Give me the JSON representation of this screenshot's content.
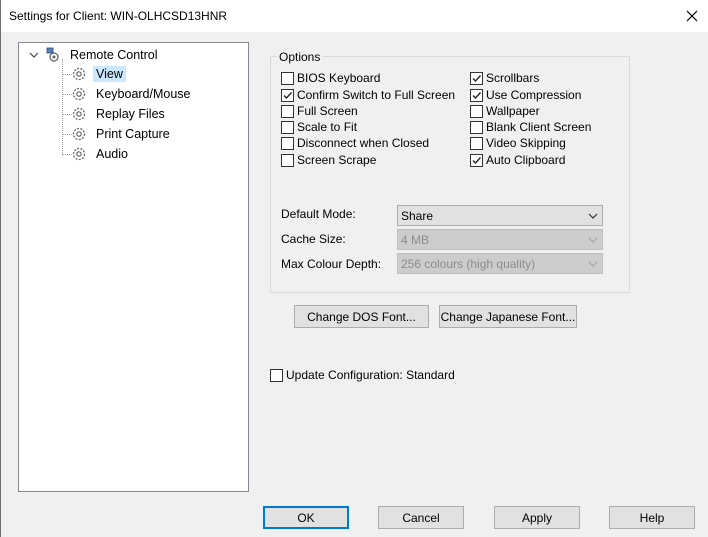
{
  "window": {
    "title": "Settings for Client: WIN-OLHCSD13HNR"
  },
  "tree": {
    "root": "Remote Control",
    "items": [
      {
        "label": "View",
        "selected": true
      },
      {
        "label": "Keyboard/Mouse",
        "selected": false
      },
      {
        "label": "Replay Files",
        "selected": false
      },
      {
        "label": "Print Capture",
        "selected": false
      },
      {
        "label": "Audio",
        "selected": false
      }
    ]
  },
  "options": {
    "group_label": "Options",
    "left": [
      {
        "label": "BIOS Keyboard",
        "checked": false
      },
      {
        "label": "Confirm Switch to Full Screen",
        "checked": true
      },
      {
        "label": "Full Screen",
        "checked": false
      },
      {
        "label": "Scale to Fit",
        "checked": false
      },
      {
        "label": "Disconnect when Closed",
        "checked": false
      },
      {
        "label": "Screen Scrape",
        "checked": false
      }
    ],
    "right": [
      {
        "label": "Scrollbars",
        "checked": true
      },
      {
        "label": "Use Compression",
        "checked": true
      },
      {
        "label": "Wallpaper",
        "checked": false
      },
      {
        "label": "Blank Client Screen",
        "checked": false
      },
      {
        "label": "Video Skipping",
        "checked": false
      },
      {
        "label": "Auto Clipboard",
        "checked": true
      }
    ],
    "default_mode": {
      "label": "Default Mode:",
      "value": "Share"
    },
    "cache_size": {
      "label": "Cache Size:",
      "value": "4 MB"
    },
    "max_colour_depth": {
      "label": "Max Colour Depth:",
      "value": "256 colours (high quality)"
    }
  },
  "font_buttons": {
    "dos": "Change DOS Font...",
    "japanese": "Change Japanese Font..."
  },
  "update_config": {
    "label": "Update Configuration: Standard",
    "checked": false
  },
  "footer": {
    "ok": "OK",
    "cancel": "Cancel",
    "apply": "Apply",
    "help": "Help"
  },
  "colors": {
    "accent": "#0078d7",
    "selection": "#cce8ff",
    "window_bg": "#f0f0f0"
  },
  "icons": {
    "close": "close-icon",
    "tree_node": "gear-icon",
    "root_node": "network-gear-icon",
    "expander": "chevron-down-icon",
    "dropdown": "chevron-down-icon",
    "check": "checkmark-icon"
  }
}
